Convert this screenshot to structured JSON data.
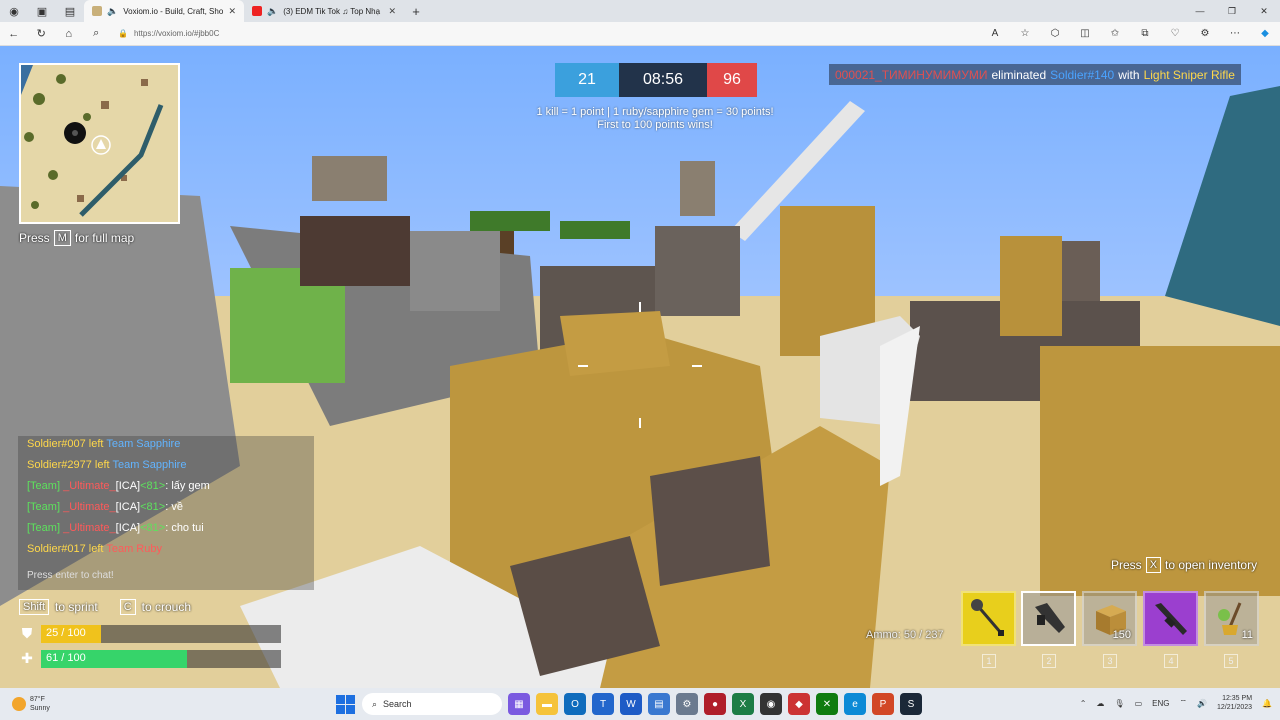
{
  "browser": {
    "tabs": [
      {
        "title": "Voxiom.io - Build, Craft, Sho",
        "active": true
      },
      {
        "title": "(3) EDM Tik Tok ♫ Top Nhạ",
        "active": false
      }
    ],
    "url": "https://voxiom.io/#jbb0C"
  },
  "hud": {
    "map_hint_prefix": "Press",
    "map_hint_key": "M",
    "map_hint_suffix": "for full map",
    "score_blue": "21",
    "timer": "08:56",
    "score_red": "96",
    "rules_line1": "1 kill = 1 point | 1 ruby/sapphire gem = 30 points!",
    "rules_line2": "First to 100 points wins!",
    "killfeed": {
      "killer": "000021_ТИМИНУМИМУМИ",
      "action": "eliminated",
      "victim": "Soldier#140",
      "with": "with",
      "weapon": "Light Sniper Rifle"
    },
    "chat": [
      {
        "who": "Soldier#007",
        "text": "left",
        "team": "Team Sapphire"
      },
      {
        "who": "Soldier#2977",
        "text": "left",
        "team": "Team Sapphire"
      },
      {
        "prefix": "[Team]",
        "name": "_Ultimate_",
        "clan": "[ICA]",
        "level": "<81>",
        "msg": ": lấy gem"
      },
      {
        "prefix": "[Team]",
        "name": "_Ultimate_",
        "clan": "[ICA]",
        "level": "<81>",
        "msg": ": về"
      },
      {
        "prefix": "[Team]",
        "name": "_Ultimate_",
        "clan": "[ICA]",
        "level": "<81>",
        "msg": ": cho tui"
      },
      {
        "who": "Soldier#017",
        "text": "left",
        "team": "Team Ruby"
      }
    ],
    "chat_placeholder": "Press enter to chat!",
    "sprint_key": "Shift",
    "sprint_label": "to sprint",
    "crouch_key": "C",
    "crouch_label": "to crouch",
    "armor_text": "25 / 100",
    "armor_fraction": 0.25,
    "health_text": "61 / 100",
    "health_fraction": 0.61,
    "inventory_hint_prefix": "Press",
    "inventory_hint_key": "X",
    "inventory_hint_suffix": "to open inventory",
    "ammo": "Ammo: 50 / 237",
    "slots": [
      {
        "num": "1",
        "item": "shovel-icon",
        "count": ""
      },
      {
        "num": "2",
        "item": "pistol-icon",
        "count": ""
      },
      {
        "num": "3",
        "item": "wood-block-icon",
        "count": "150"
      },
      {
        "num": "4",
        "item": "rifle-icon",
        "count": ""
      },
      {
        "num": "5",
        "item": "broom-icon",
        "count": "11"
      }
    ]
  },
  "taskbar": {
    "temp": "87°F",
    "condition": "Sunny",
    "search_placeholder": "Search",
    "lang": "ENG",
    "time": "12:35 PM",
    "date": "12/21/2023"
  }
}
